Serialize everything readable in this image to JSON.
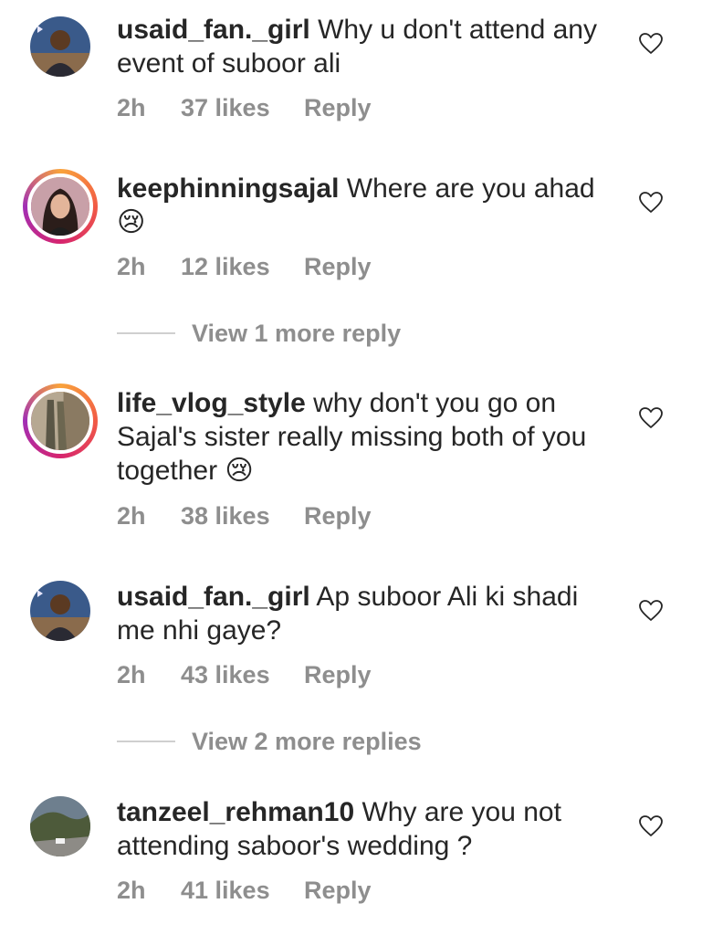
{
  "comments": [
    {
      "username": "usaid_fan._girl",
      "text": "Why u don't attend any event of suboor ali",
      "time": "2h",
      "likes": "37 likes",
      "reply": "Reply"
    },
    {
      "username": "keephinningsajal",
      "text": "Where are you ahad 😢",
      "time": "2h",
      "likes": "12 likes",
      "reply": "Reply"
    },
    {
      "username": "life_vlog_style",
      "text": "why don't you go on Sajal's sister really missing both of you together 😢",
      "time": "2h",
      "likes": "38 likes",
      "reply": "Reply"
    },
    {
      "username": "usaid_fan._girl",
      "text": "Ap suboor Ali ki shadi me nhi gaye?",
      "time": "2h",
      "likes": "43 likes",
      "reply": "Reply"
    },
    {
      "username": "tanzeel_rehman10",
      "text": "Why are you not attending saboor's wedding ?",
      "time": "2h",
      "likes": "41 likes",
      "reply": "Reply"
    }
  ],
  "view_more": [
    {
      "label": "View 1 more reply"
    },
    {
      "label": "View 2 more replies"
    }
  ],
  "icons": {
    "like": "heart-outline-icon"
  },
  "colors": {
    "text": "#262626",
    "secondary": "#8e8e8e",
    "story_ring": "#d6246e"
  }
}
